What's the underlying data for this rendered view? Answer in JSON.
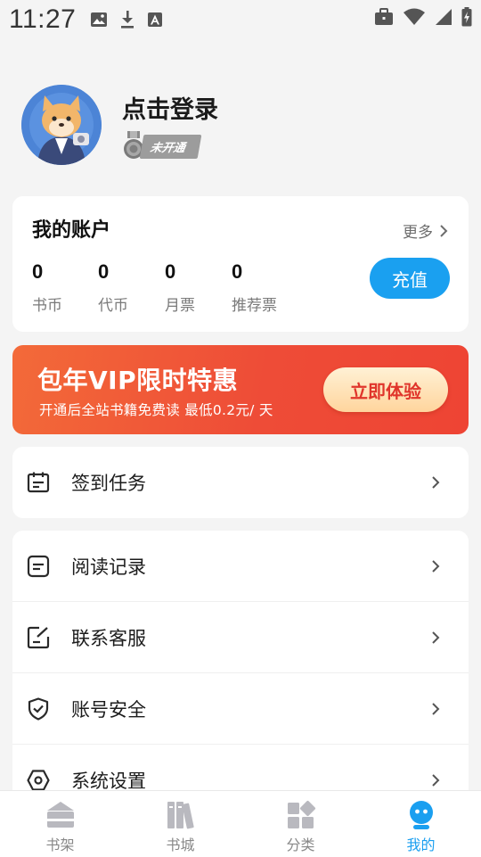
{
  "status_bar": {
    "time": "11:27"
  },
  "profile": {
    "login_text": "点击登录",
    "member_status": "未开通"
  },
  "account": {
    "title": "我的账户",
    "more_label": "更多",
    "stats": [
      {
        "value": "0",
        "label": "书币"
      },
      {
        "value": "0",
        "label": "代币"
      },
      {
        "value": "0",
        "label": "月票"
      },
      {
        "value": "0",
        "label": "推荐票"
      }
    ],
    "recharge_label": "充值"
  },
  "vip": {
    "title": "包年VIP限时特惠",
    "subtitle": "开通后全站书籍免费读 最低0.2元/ 天",
    "button_label": "立即体验"
  },
  "menu": {
    "checkin": {
      "label": "签到任务",
      "icon": "calendar-icon"
    },
    "items": [
      {
        "label": "阅读记录",
        "icon": "reading-record-icon"
      },
      {
        "label": "联系客服",
        "icon": "edit-note-icon"
      },
      {
        "label": "账号安全",
        "icon": "shield-check-icon"
      },
      {
        "label": "系统设置",
        "icon": "hexagon-settings-icon"
      }
    ]
  },
  "bottom_nav": {
    "items": [
      {
        "label": "书架",
        "icon": "bookshelf-icon"
      },
      {
        "label": "书城",
        "icon": "bookstore-icon"
      },
      {
        "label": "分类",
        "icon": "category-icon"
      },
      {
        "label": "我的",
        "icon": "profile-icon"
      }
    ],
    "active": "我的"
  },
  "colors": {
    "accent": "#1aa0f0",
    "vip_red": "#ee4c37",
    "vip_button_text": "#e0352b",
    "background": "#f4f4f4"
  }
}
